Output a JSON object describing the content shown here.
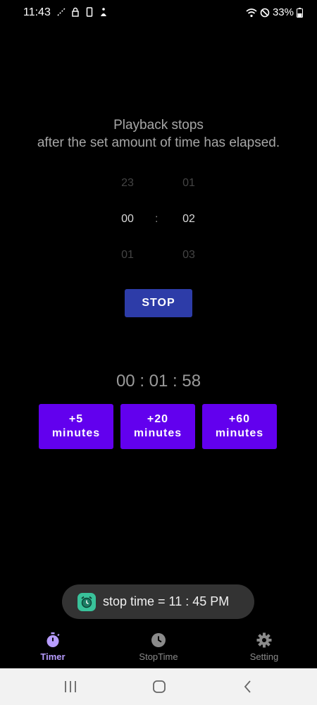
{
  "status_bar": {
    "time": "11:43",
    "battery": "33%"
  },
  "description": {
    "line1": "Playback stops",
    "line2": "after the set amount of time has elapsed."
  },
  "picker": {
    "hours": {
      "prev": "23",
      "current": "00",
      "next": "01"
    },
    "separator": ":",
    "minutes": {
      "prev": "01",
      "current": "02",
      "next": "03"
    }
  },
  "stop_button": {
    "label": "STOP"
  },
  "countdown": {
    "text": "00 : 01 : 58"
  },
  "add_buttons": [
    {
      "line1": "+5",
      "line2": "minutes"
    },
    {
      "line1": "+20",
      "line2": "minutes"
    },
    {
      "line1": "+60",
      "line2": "minutes"
    }
  ],
  "toast": {
    "text": "stop time =  11 : 45 PM",
    "icon": "alarm-clock-icon"
  },
  "bottom_nav": {
    "items": [
      {
        "label": "Timer",
        "icon": "stopwatch-icon"
      },
      {
        "label": "StopTime",
        "icon": "clock-icon"
      },
      {
        "label": "Setting",
        "icon": "gear-icon"
      }
    ]
  },
  "colors": {
    "accent": "#6200ee",
    "stop_button": "#2d3ca8",
    "active_nav": "#b79cff"
  }
}
